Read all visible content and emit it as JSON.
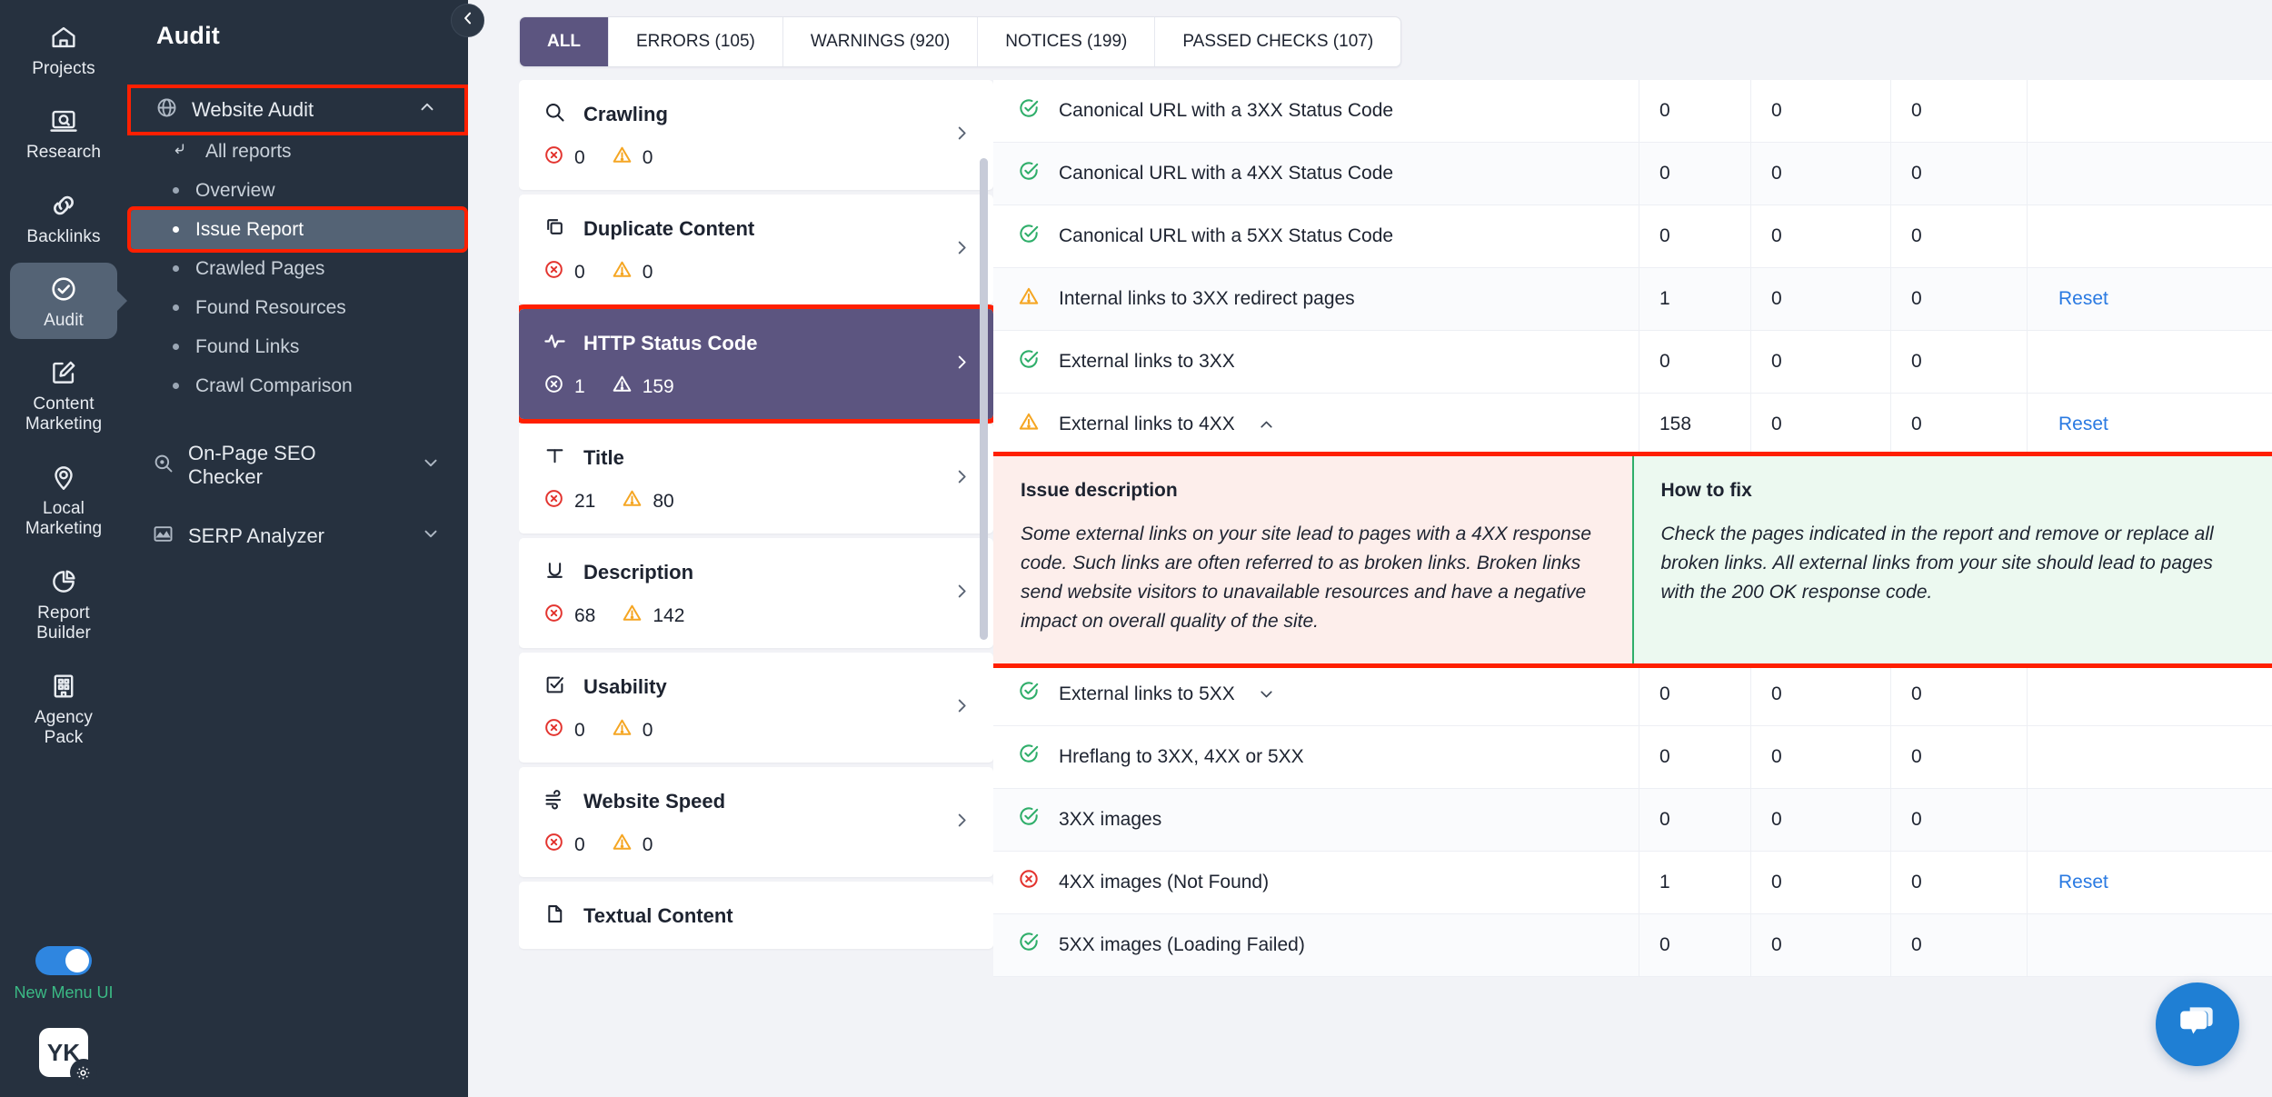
{
  "rail": {
    "items": [
      {
        "label": "Projects",
        "icon": "home-icon"
      },
      {
        "label": "Research",
        "icon": "research-icon"
      },
      {
        "label": "Backlinks",
        "icon": "link-icon"
      },
      {
        "label": "Audit",
        "icon": "check-circle-icon"
      },
      {
        "label": "Content Marketing",
        "icon": "edit-icon"
      },
      {
        "label": "Local Marketing",
        "icon": "location-pin-icon"
      },
      {
        "label": "Report Builder",
        "icon": "pie-chart-icon"
      },
      {
        "label": "Agency Pack",
        "icon": "building-icon"
      }
    ],
    "toggle_label": "New Menu UI",
    "avatar_initials": "YK"
  },
  "sidebar": {
    "title": "Audit",
    "group": {
      "label": "Website Audit",
      "icon": "globe-icon",
      "chevron": "chevron-up-icon"
    },
    "items": [
      {
        "label": "All reports",
        "icon": "return-arrow-icon"
      },
      {
        "label": "Overview",
        "icon": "dot-icon"
      },
      {
        "label": "Issue Report",
        "icon": "dot-icon"
      },
      {
        "label": "Crawled Pages",
        "icon": "dot-icon"
      },
      {
        "label": "Found Resources",
        "icon": "dot-icon"
      },
      {
        "label": "Found Links",
        "icon": "dot-icon"
      },
      {
        "label": "Crawl Comparison",
        "icon": "dot-icon"
      }
    ],
    "other_groups": [
      {
        "label": "On-Page SEO Checker",
        "icon": "target-search-icon",
        "chevron": "chevron-down-icon"
      },
      {
        "label": "SERP Analyzer",
        "icon": "chart-mountain-icon",
        "chevron": "chevron-down-icon"
      }
    ]
  },
  "tabs": [
    {
      "label": "ALL",
      "active": true
    },
    {
      "label": "ERRORS (105)",
      "active": false
    },
    {
      "label": "WARNINGS (920)",
      "active": false
    },
    {
      "label": "NOTICES (199)",
      "active": false
    },
    {
      "label": "PASSED CHECKS (107)",
      "active": false
    }
  ],
  "cards": [
    {
      "title": "Crawling",
      "icon": "magnifier-icon",
      "errors": "0",
      "warnings": "0",
      "selected": false
    },
    {
      "title": "Duplicate Content",
      "icon": "copy-icon",
      "errors": "0",
      "warnings": "0",
      "selected": false
    },
    {
      "title": "HTTP Status Code",
      "icon": "pulse-icon",
      "errors": "1",
      "warnings": "159",
      "selected": true
    },
    {
      "title": "Title",
      "icon": "text-t-icon",
      "errors": "21",
      "warnings": "80",
      "selected": false
    },
    {
      "title": "Description",
      "icon": "underline-u-icon",
      "errors": "68",
      "warnings": "142",
      "selected": false
    },
    {
      "title": "Usability",
      "icon": "checkbox-icon",
      "errors": "0",
      "warnings": "0",
      "selected": false
    },
    {
      "title": "Website Speed",
      "icon": "wind-icon",
      "errors": "0",
      "warnings": "0",
      "selected": false
    },
    {
      "title": "Textual Content",
      "icon": "document-icon",
      "errors": "",
      "warnings": "",
      "selected": false
    }
  ],
  "table": {
    "rows": [
      {
        "name": "Canonical URL with a 3XX Status Code",
        "status": "passed",
        "c1": "0",
        "c2": "0",
        "c3": "0",
        "action": ""
      },
      {
        "name": "Canonical URL with a 4XX Status Code",
        "status": "passed",
        "c1": "0",
        "c2": "0",
        "c3": "0",
        "action": ""
      },
      {
        "name": "Canonical URL with a 5XX Status Code",
        "status": "passed",
        "c1": "0",
        "c2": "0",
        "c3": "0",
        "action": ""
      },
      {
        "name": "Internal links to 3XX redirect pages",
        "status": "warning",
        "c1": "1",
        "c2": "0",
        "c3": "0",
        "action": "Reset"
      },
      {
        "name": "External links to 3XX",
        "status": "passed",
        "c1": "0",
        "c2": "0",
        "c3": "0",
        "action": ""
      },
      {
        "name": "External links to 4XX",
        "status": "warning",
        "c1": "158",
        "c2": "0",
        "c3": "0",
        "action": "Reset",
        "expanded": true
      },
      {
        "name": "External links to 5XX",
        "status": "passed",
        "c1": "0",
        "c2": "0",
        "c3": "0",
        "action": "",
        "collapsible": true
      },
      {
        "name": "Hreflang to 3XX, 4XX or 5XX",
        "status": "passed",
        "c1": "0",
        "c2": "0",
        "c3": "0",
        "action": ""
      },
      {
        "name": "3XX images",
        "status": "passed",
        "c1": "0",
        "c2": "0",
        "c3": "0",
        "action": ""
      },
      {
        "name": "4XX images (Not Found)",
        "status": "error",
        "c1": "1",
        "c2": "0",
        "c3": "0",
        "action": "Reset"
      },
      {
        "name": "5XX images (Loading Failed)",
        "status": "passed",
        "c1": "0",
        "c2": "0",
        "c3": "0",
        "action": ""
      }
    ]
  },
  "detail": {
    "issue_heading": "Issue description",
    "issue_body": "Some external links on your site lead to pages with a 4XX response code. Such links are often referred to as broken links. Broken links send website visitors to unavailable resources and have a negative impact on overall quality of the site.",
    "fix_heading": "How to fix",
    "fix_body": "Check the pages indicated in the report and remove or replace all broken links. All external links from your site should lead to pages with the 200 OK response code."
  },
  "colors": {
    "accent_purple": "#5c5580",
    "error_red": "#e3342f",
    "warning_amber": "#f5a623",
    "passed_green": "#2fae6a",
    "link_blue": "#2a7ae2",
    "highlight_red": "#ff1f00",
    "rail_bg": "#26313f",
    "toggle_green": "#3bba85"
  },
  "chat": {
    "icon": "chat-bubble-icon"
  }
}
